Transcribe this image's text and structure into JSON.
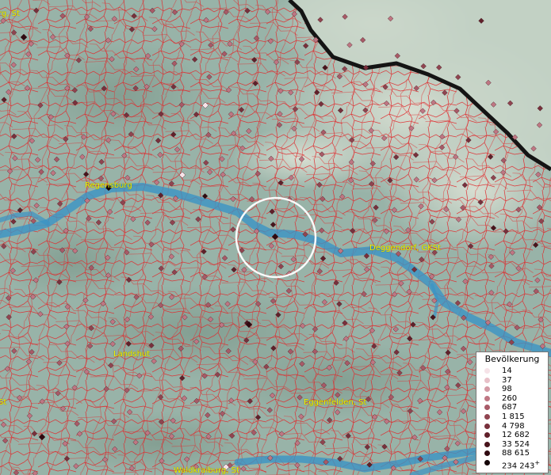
{
  "places": {
    "top_left_partial": "rg, St",
    "regensburg": "Regensburg",
    "deggendorf": "Deggendorf, GKSt",
    "landshut": "Landshut",
    "eggenfelden": "Eggenfelden, St",
    "waldkraiburg": "Waldkraiburg, St",
    "left_edge_partial": "St"
  },
  "legend": {
    "title": "Bevölkerung",
    "classes": [
      {
        "label": "14",
        "color": "#f6e3e8"
      },
      {
        "label": "37",
        "color": "#e8c0c8"
      },
      {
        "label": "98",
        "color": "#d49aa5"
      },
      {
        "label": "260",
        "color": "#bf7683"
      },
      {
        "label": "687",
        "color": "#a85a67"
      },
      {
        "label": "1 815",
        "color": "#904450"
      },
      {
        "label": "4 798",
        "color": "#78303c"
      },
      {
        "label": "12 682",
        "color": "#60202a"
      },
      {
        "label": "33 524",
        "color": "#48141c"
      },
      {
        "label": "88 615",
        "color": "#300a10"
      },
      {
        "label": "234 243",
        "color": "#140406"
      }
    ],
    "open_end_marker": "+"
  },
  "colors": {
    "land": "#98b3a8",
    "highland": "#c8d2c2",
    "river": "#3b93c4",
    "boundary": "#e0282b",
    "state_border": "#141414",
    "label": "#f2f200",
    "highlight_ring": "#ffffff"
  },
  "layers": {
    "icons": [
      "municipality-boundaries",
      "population-symbols",
      "rivers",
      "state-border",
      "selection-ring"
    ]
  }
}
